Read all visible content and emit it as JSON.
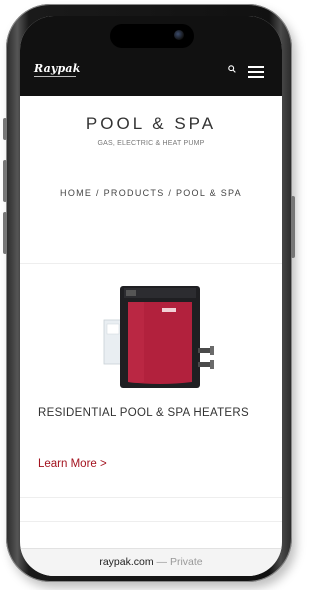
{
  "header": {
    "logo_text": "Raypak",
    "search_icon": "search-icon",
    "menu_icon": "hamburger-menu-icon"
  },
  "page": {
    "title": "POOL & SPA",
    "subtitle": "GAS, ELECTRIC & HEAT PUMP"
  },
  "breadcrumb": {
    "items": [
      "HOME",
      "PRODUCTS",
      "POOL & SPA"
    ],
    "separator": " / "
  },
  "product": {
    "title": "RESIDENTIAL POOL & SPA HEATERS",
    "link_label": "Learn More >",
    "image_label": "Raypak"
  },
  "browser": {
    "url": "raypak.com",
    "separator": " — ",
    "mode": "Private"
  },
  "colors": {
    "header_bg": "#111111",
    "accent": "#a3121e",
    "heater_red": "#b2213d"
  }
}
